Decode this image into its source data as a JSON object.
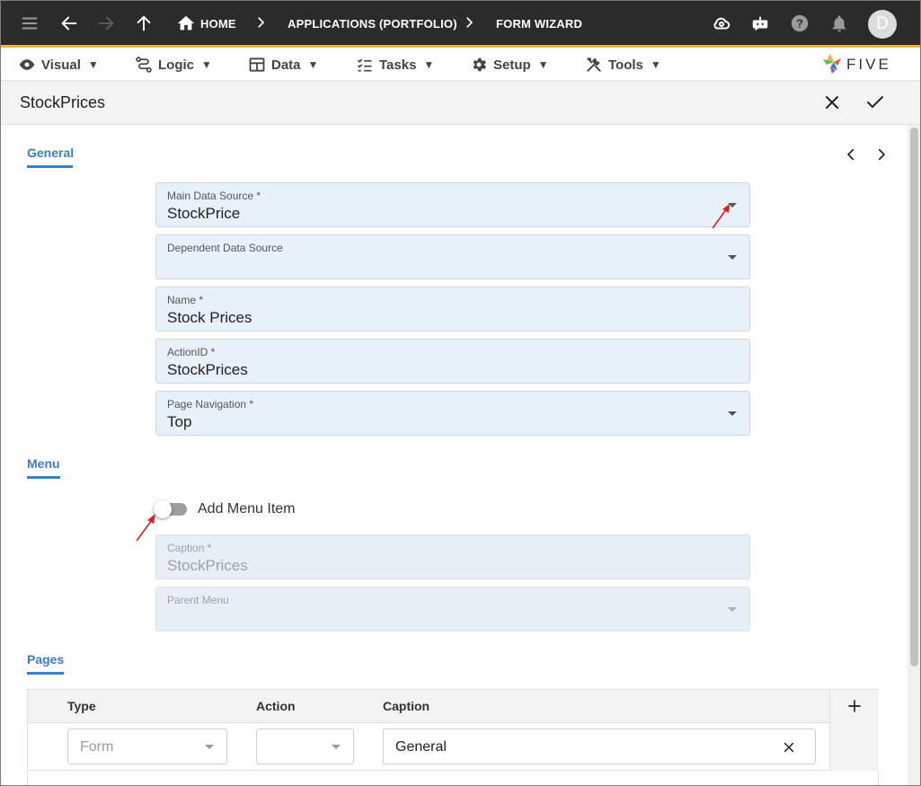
{
  "appbar": {
    "breadcrumbs": [
      "HOME",
      "APPLICATIONS (PORTFOLIO)",
      "FORM WIZARD"
    ],
    "avatar_initial": "D",
    "icons": [
      "hamburger-icon",
      "back-arrow-icon",
      "forward-arrow-icon",
      "up-arrow-icon",
      "home-icon",
      "cloud-sync-icon",
      "chat-bot-icon",
      "help-icon",
      "notification-bell-icon"
    ]
  },
  "menubar": {
    "items": [
      {
        "label": "Visual",
        "icon": "eye-icon"
      },
      {
        "label": "Logic",
        "icon": "flow-icon"
      },
      {
        "label": "Data",
        "icon": "table-icon"
      },
      {
        "label": "Tasks",
        "icon": "checklist-icon"
      },
      {
        "label": "Setup",
        "icon": "gear-icon"
      },
      {
        "label": "Tools",
        "icon": "tools-icon"
      }
    ],
    "caret": "▼",
    "logo_text": "FIVE"
  },
  "titlebar": {
    "title": "StockPrices"
  },
  "general": {
    "tab_label": "General",
    "fields": [
      {
        "label": "Main Data Source *",
        "value": "StockPrice",
        "dropdown": true
      },
      {
        "label": "Dependent Data Source",
        "value": "",
        "dropdown": true
      },
      {
        "label": "Name *",
        "value": "Stock Prices",
        "dropdown": false
      },
      {
        "label": "ActionID *",
        "value": "StockPrices",
        "dropdown": false
      },
      {
        "label": "Page Navigation *",
        "value": "Top",
        "dropdown": true
      }
    ]
  },
  "menu": {
    "tab_label": "Menu",
    "toggle_label": "Add Menu Item",
    "toggle_on": false,
    "fields": [
      {
        "label": "Caption *",
        "value": "StockPrices",
        "dropdown": false
      },
      {
        "label": "Parent Menu",
        "value": "",
        "dropdown": true
      }
    ]
  },
  "pages": {
    "tab_label": "Pages",
    "columns": [
      "Type",
      "Action",
      "Caption"
    ],
    "rows": [
      {
        "type_placeholder": "Form",
        "action": "",
        "caption": "General"
      }
    ]
  },
  "colors": {
    "accent": "#3b7ec9",
    "appbar_bg": "#2b2b2b",
    "appbar_border": "#f1b434",
    "field_bg": "#e8f0fa",
    "annotation_arrow": "#e02020"
  }
}
